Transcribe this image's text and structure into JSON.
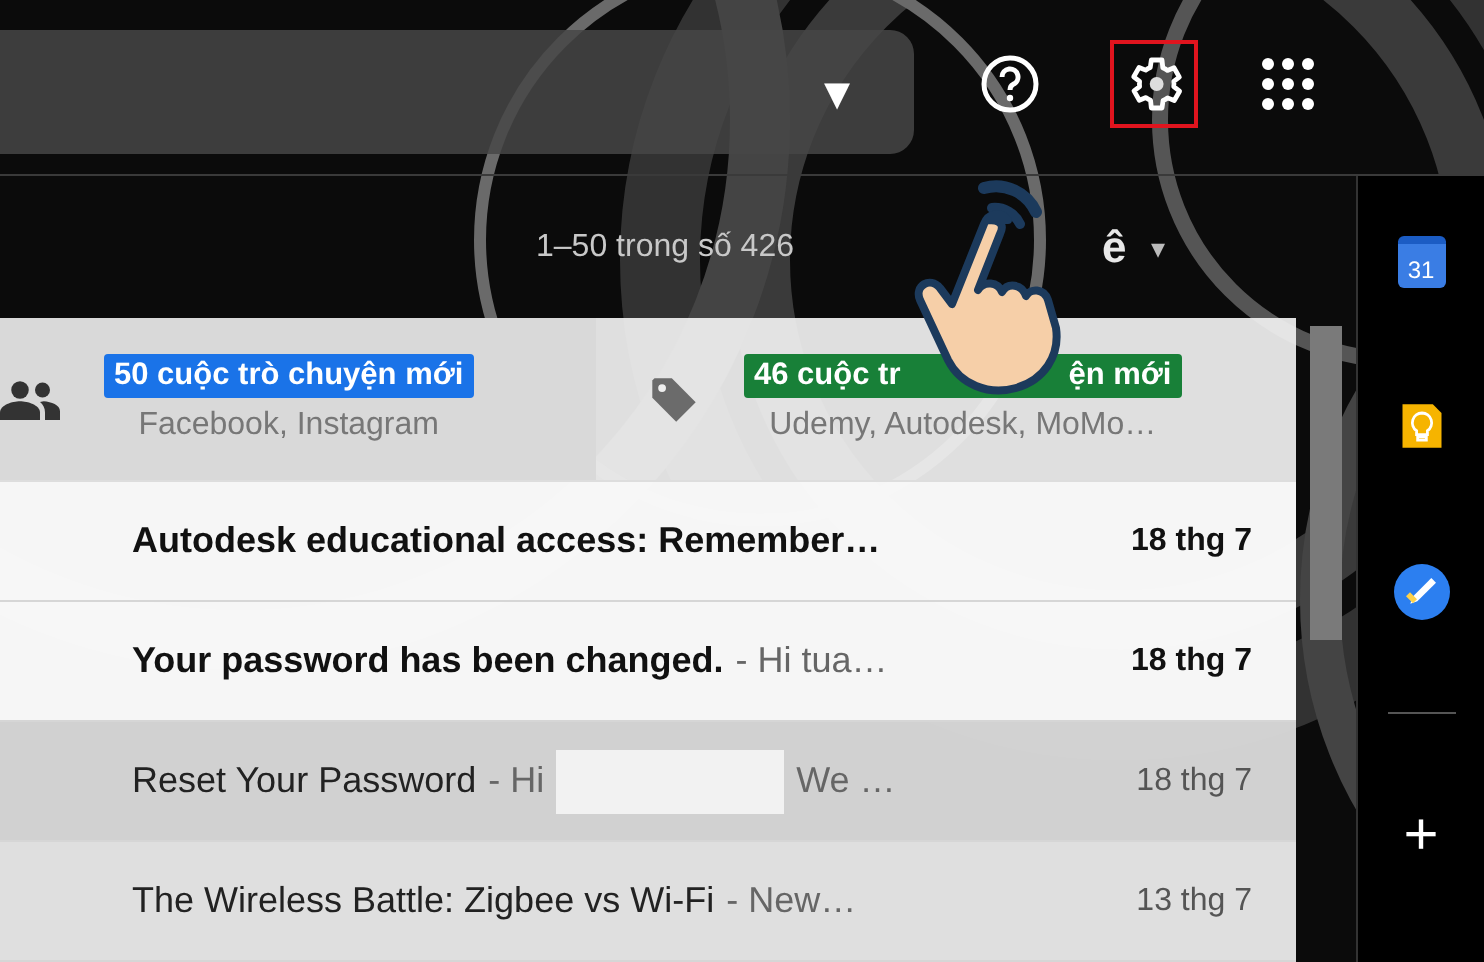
{
  "search": {
    "dropdown": "▾"
  },
  "toolbar": {
    "range": "1–50 trong số 426",
    "input_tool": "ê",
    "input_caret": "▾"
  },
  "category_tabs": [
    {
      "kind": "social",
      "badge": [
        "50 cuộc trò chuyện mới"
      ],
      "color": "#1a73e8",
      "senders": "Facebook, Instagram",
      "selected": true
    },
    {
      "kind": "promotions",
      "badge": [
        "46 cuộc tr",
        "ện mới"
      ],
      "color": "#188038",
      "senders": "Udemy, Autodesk, MoMo…",
      "selected": false
    }
  ],
  "emails": [
    {
      "subject": "Autodesk educational access: Remember…",
      "unread": true,
      "hovered": false,
      "date": "18 thg 7"
    },
    {
      "subject": "Your password has been changed.",
      "snippet": "- Hi tua…",
      "unread": true,
      "hovered": false,
      "date": "18 thg 7"
    },
    {
      "subject": "Reset Your Password",
      "snippet": "- Hi",
      "redacted": true,
      "snippet_end": "We …",
      "unread": false,
      "hovered": true,
      "date": "18 thg 7"
    },
    {
      "subject": "The Wireless Battle: Zigbee vs Wi-Fi",
      "snippet": "- New…",
      "unread": false,
      "hovered": false,
      "date": "13 thg 7"
    }
  ],
  "side_apps": [
    {
      "kind": "calendar",
      "label": "31"
    },
    {
      "kind": "keep"
    },
    {
      "kind": "tasks"
    }
  ],
  "side_add": "+"
}
